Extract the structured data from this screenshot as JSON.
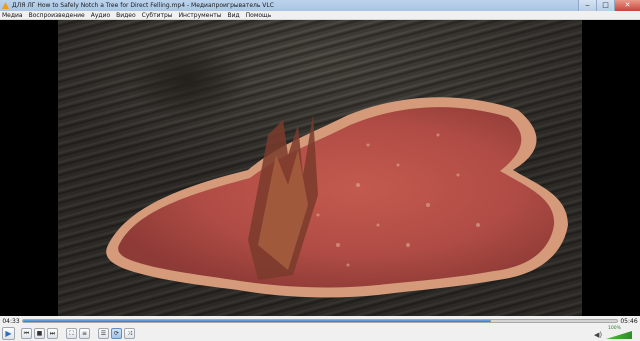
{
  "window": {
    "title": "ДЛЯ ЛГ How to Safely Notch a Tree for Direct Felling.mp4 - Медиапроигрыватель VLC",
    "minimize_glyph": "‒",
    "maximize_glyph": "□",
    "close_glyph": "✕"
  },
  "menu": {
    "items": [
      "Медиа",
      "Воспроизведение",
      "Аудио",
      "Видео",
      "Субтитры",
      "Инструменты",
      "Вид",
      "Помощь"
    ]
  },
  "playback": {
    "current_time": "04:33",
    "total_time": "05:46",
    "progress": 0.788
  },
  "controls": {
    "play_glyph": "▶",
    "prev_glyph": "⏮",
    "stop_glyph": "■",
    "next_glyph": "⏭",
    "fullscreen_glyph": "⛶",
    "ext_settings_glyph": "≡",
    "playlist_glyph": "☰",
    "loop_glyph": "⟳",
    "random_glyph": "⤨"
  },
  "volume": {
    "label": "100%",
    "icon_glyph": "◀)",
    "level": 1.0
  },
  "colors": {
    "accent": "#2f76c9",
    "volume": "#2c8f22"
  }
}
